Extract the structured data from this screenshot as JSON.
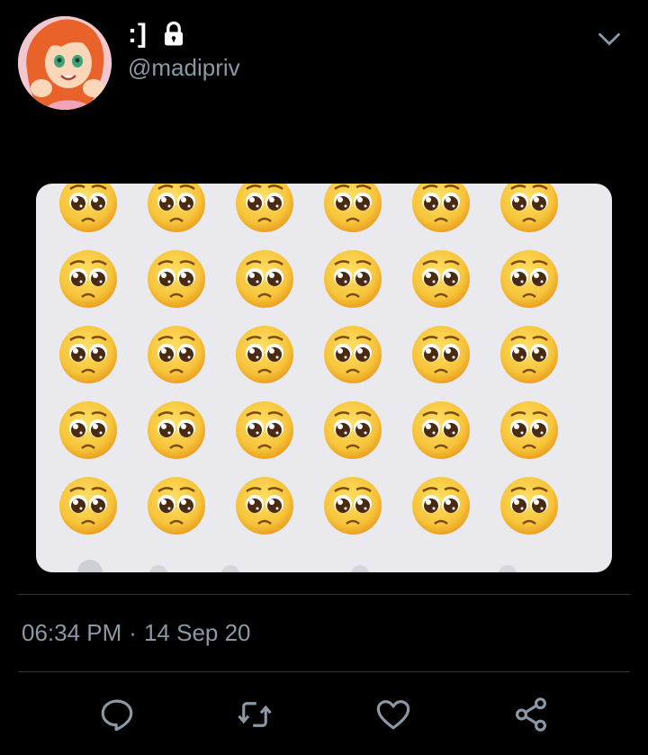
{
  "tweet": {
    "display_name": ":]",
    "handle": "@madipriv",
    "time": "06:34 PM",
    "separator": "·",
    "date": "14 Sep 20",
    "protected": true
  },
  "media": {
    "description_icon": "pleading-face-emoji",
    "rows": 5,
    "columns": 6
  },
  "icons": {
    "lock": "lock-icon",
    "more": "chevron-down-icon",
    "reply": "reply-icon",
    "retweet": "retweet-icon",
    "like": "heart-icon",
    "share": "share-icon"
  },
  "colors": {
    "background": "#000000",
    "text_primary": "#ffffff",
    "text_secondary": "#8b98a5",
    "divider": "#2f3336",
    "media_background": "#e9e9ee",
    "emoji_face": "#f6c43a"
  }
}
